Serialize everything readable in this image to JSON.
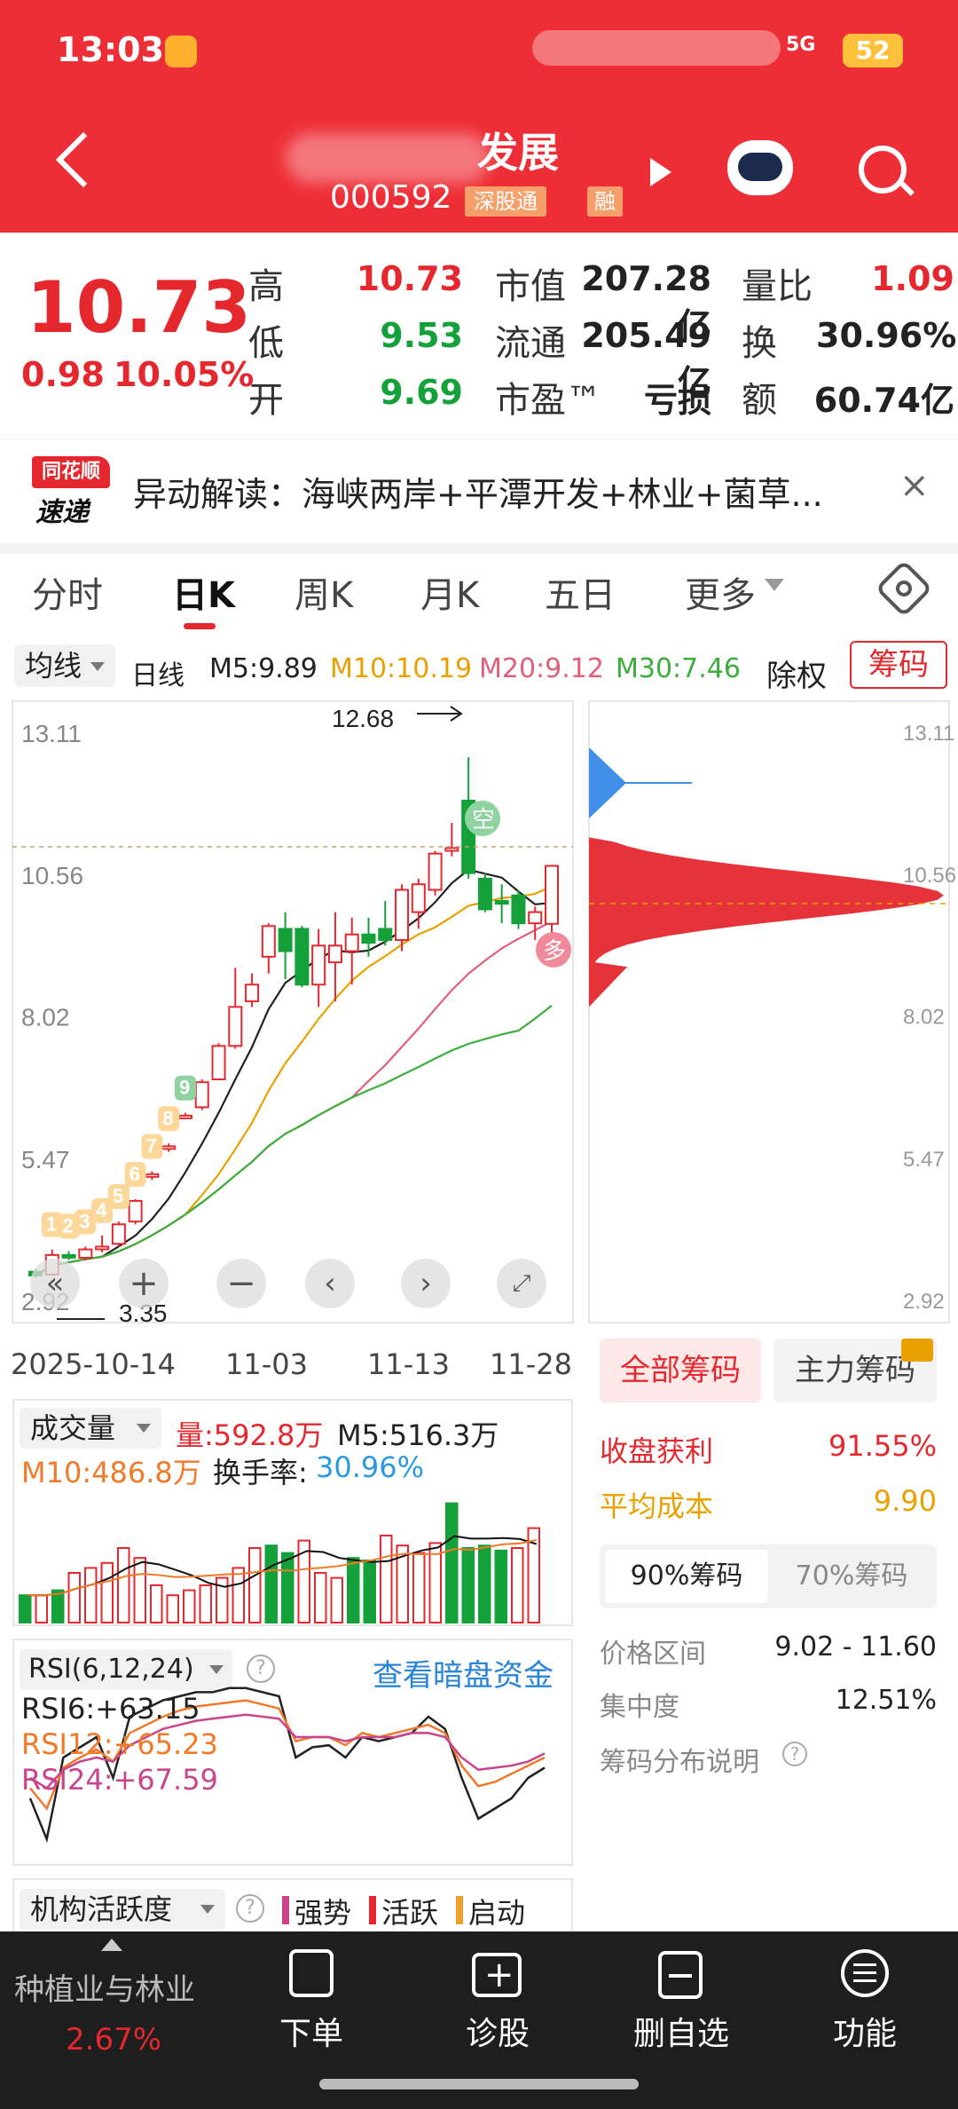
{
  "status": {
    "time": "13:03",
    "net": "5G",
    "battery": "52"
  },
  "header": {
    "stock_name": "发展",
    "stock_code": "000592",
    "tag_sz": "深股通",
    "tag_rong": "融"
  },
  "quote": {
    "price": "10.73",
    "change": "0.98",
    "pct": "10.05%",
    "fields": [
      {
        "label": "高",
        "value": "10.73",
        "color": "red"
      },
      {
        "label": "低",
        "value": "9.53",
        "color": "green"
      },
      {
        "label": "开",
        "value": "9.69",
        "color": "green"
      },
      {
        "label": "市值",
        "value": "207.28亿",
        "color": "dark"
      },
      {
        "label": "流通",
        "value": "205.49亿",
        "color": "dark"
      },
      {
        "label": "市盈™",
        "value": "亏损",
        "color": "dark"
      },
      {
        "label": "量比",
        "value": "1.09",
        "color": "red"
      },
      {
        "label": "换",
        "value": "30.96%",
        "color": "dark"
      },
      {
        "label": "额",
        "value": "60.74亿",
        "color": "dark"
      }
    ]
  },
  "news": {
    "logo_top": "同花顺",
    "logo_bottom": "速递",
    "text": "异动解读：海峡两岸+平潭开发+林业+菌草..."
  },
  "tabs": [
    "分时",
    "日K",
    "周K",
    "月K",
    "五日",
    "更多"
  ],
  "ma": {
    "select": "均线",
    "type": "日线",
    "m5": "M5:9.89",
    "m10": "M10:10.19",
    "m20": "M20:9.12",
    "m30": "M30:7.46",
    "adjust": "除权",
    "chip_btn": "筹码"
  },
  "kchart": {
    "y_ticks": [
      "13.11",
      "10.56",
      "8.02",
      "5.47",
      "2.92"
    ],
    "x_ticks": [
      "2025-10-14",
      "11-03",
      "11-13",
      "11-28"
    ],
    "high_label": "12.68",
    "low_label": "3.35",
    "tag_kong": "空",
    "tag_duo": "多"
  },
  "chart_data": {
    "type": "candlestick",
    "x_range": [
      "2025-10-14",
      "11-28"
    ],
    "ylim": [
      2.92,
      13.11
    ],
    "high": 12.68,
    "low": 3.35,
    "candles": [
      {
        "o": 3.45,
        "c": 3.38,
        "h": 3.5,
        "l": 3.35
      },
      {
        "o": 3.4,
        "c": 3.75,
        "h": 3.85,
        "l": 3.38
      },
      {
        "o": 3.75,
        "c": 3.72,
        "h": 3.82,
        "l": 3.66
      },
      {
        "o": 3.7,
        "c": 3.85,
        "h": 3.9,
        "l": 3.65
      },
      {
        "o": 3.86,
        "c": 3.9,
        "h": 4.1,
        "l": 3.8
      },
      {
        "o": 3.95,
        "c": 4.3,
        "h": 4.35,
        "l": 3.9
      },
      {
        "o": 4.35,
        "c": 4.72,
        "h": 4.75,
        "l": 4.3
      },
      {
        "o": 5.2,
        "c": 5.2,
        "h": 5.25,
        "l": 5.1
      },
      {
        "o": 5.7,
        "c": 5.7,
        "h": 5.75,
        "l": 5.6
      },
      {
        "o": 6.25,
        "c": 6.25,
        "h": 6.3,
        "l": 6.2
      },
      {
        "o": 6.4,
        "c": 6.85,
        "h": 6.9,
        "l": 6.35
      },
      {
        "o": 6.9,
        "c": 7.5,
        "h": 7.55,
        "l": 6.9
      },
      {
        "o": 7.5,
        "c": 8.2,
        "h": 8.9,
        "l": 7.45
      },
      {
        "o": 8.3,
        "c": 8.6,
        "h": 8.8,
        "l": 8.2
      },
      {
        "o": 9.1,
        "c": 9.65,
        "h": 9.7,
        "l": 8.8
      },
      {
        "o": 9.6,
        "c": 9.2,
        "h": 9.9,
        "l": 8.7
      },
      {
        "o": 9.6,
        "c": 8.6,
        "h": 9.65,
        "l": 8.55
      },
      {
        "o": 8.6,
        "c": 9.3,
        "h": 9.6,
        "l": 8.2
      },
      {
        "o": 9.0,
        "c": 9.3,
        "h": 9.9,
        "l": 8.3
      },
      {
        "o": 9.2,
        "c": 9.5,
        "h": 9.8,
        "l": 8.6
      },
      {
        "o": 9.5,
        "c": 9.35,
        "h": 9.8,
        "l": 9.1
      },
      {
        "o": 9.6,
        "c": 9.4,
        "h": 10.1,
        "l": 9.3
      },
      {
        "o": 9.4,
        "c": 10.3,
        "h": 10.4,
        "l": 9.2
      },
      {
        "o": 9.9,
        "c": 10.4,
        "h": 10.5,
        "l": 9.6
      },
      {
        "o": 10.3,
        "c": 10.95,
        "h": 11.0,
        "l": 10.2
      },
      {
        "o": 11.0,
        "c": 11.05,
        "h": 11.5,
        "l": 10.9
      },
      {
        "o": 11.9,
        "c": 10.6,
        "h": 12.68,
        "l": 10.5
      },
      {
        "o": 10.5,
        "c": 9.95,
        "h": 10.6,
        "l": 9.9
      },
      {
        "o": 10.1,
        "c": 10.05,
        "h": 10.4,
        "l": 9.7
      },
      {
        "o": 10.2,
        "c": 9.7,
        "h": 10.3,
        "l": 9.6
      },
      {
        "o": 9.7,
        "c": 9.9,
        "h": 10.0,
        "l": 9.4
      },
      {
        "o": 9.69,
        "c": 10.73,
        "h": 10.73,
        "l": 9.53
      }
    ],
    "ma": {
      "M5": 9.89,
      "M10": 10.19,
      "M20": 9.12,
      "M30": 7.46
    }
  },
  "chip": {
    "y_ticks": [
      "13.11",
      "10.56",
      "8.02",
      "5.47",
      "2.92"
    ],
    "tab_all": "全部筹码",
    "tab_main": "主力筹码",
    "profit_label": "收盘获利",
    "profit_value": "91.55%",
    "avg_label": "平均成本",
    "avg_value": "9.90",
    "sub90": "90%筹码",
    "sub70": "70%筹码",
    "range_label": "价格区间",
    "range_value": "9.02 - 11.60",
    "conc_label": "集中度",
    "conc_value": "12.51%",
    "desc": "筹码分布说明"
  },
  "volume": {
    "select": "成交量",
    "vol": "量:592.8万",
    "m5": "M5:516.3万",
    "m10": "M10:486.8万",
    "turnover_label": "换手率:",
    "turnover": "30.96%"
  },
  "rsi": {
    "select": "RSI(6,12,24)",
    "hidden_fund": "查看暗盘资金",
    "rsi6": "RSI6:+63.15",
    "rsi12": "RSI12:+65.23",
    "rsi24": "RSI24:+67.59"
  },
  "inst": {
    "select": "机构活跃度",
    "strong": "强势",
    "active": "活跃",
    "start": "启动"
  },
  "bottom": {
    "sector": "种植业与林业",
    "sector_pct": "2.67%",
    "items": [
      "下单",
      "诊股",
      "删自选",
      "功能"
    ]
  },
  "colors": {
    "accent": "#ee2e36",
    "up": "#e5282e",
    "down": "#14a13a",
    "m5": "#222222",
    "m10": "#e9a100",
    "m20": "#e0607a",
    "m30": "#3cae3c"
  }
}
